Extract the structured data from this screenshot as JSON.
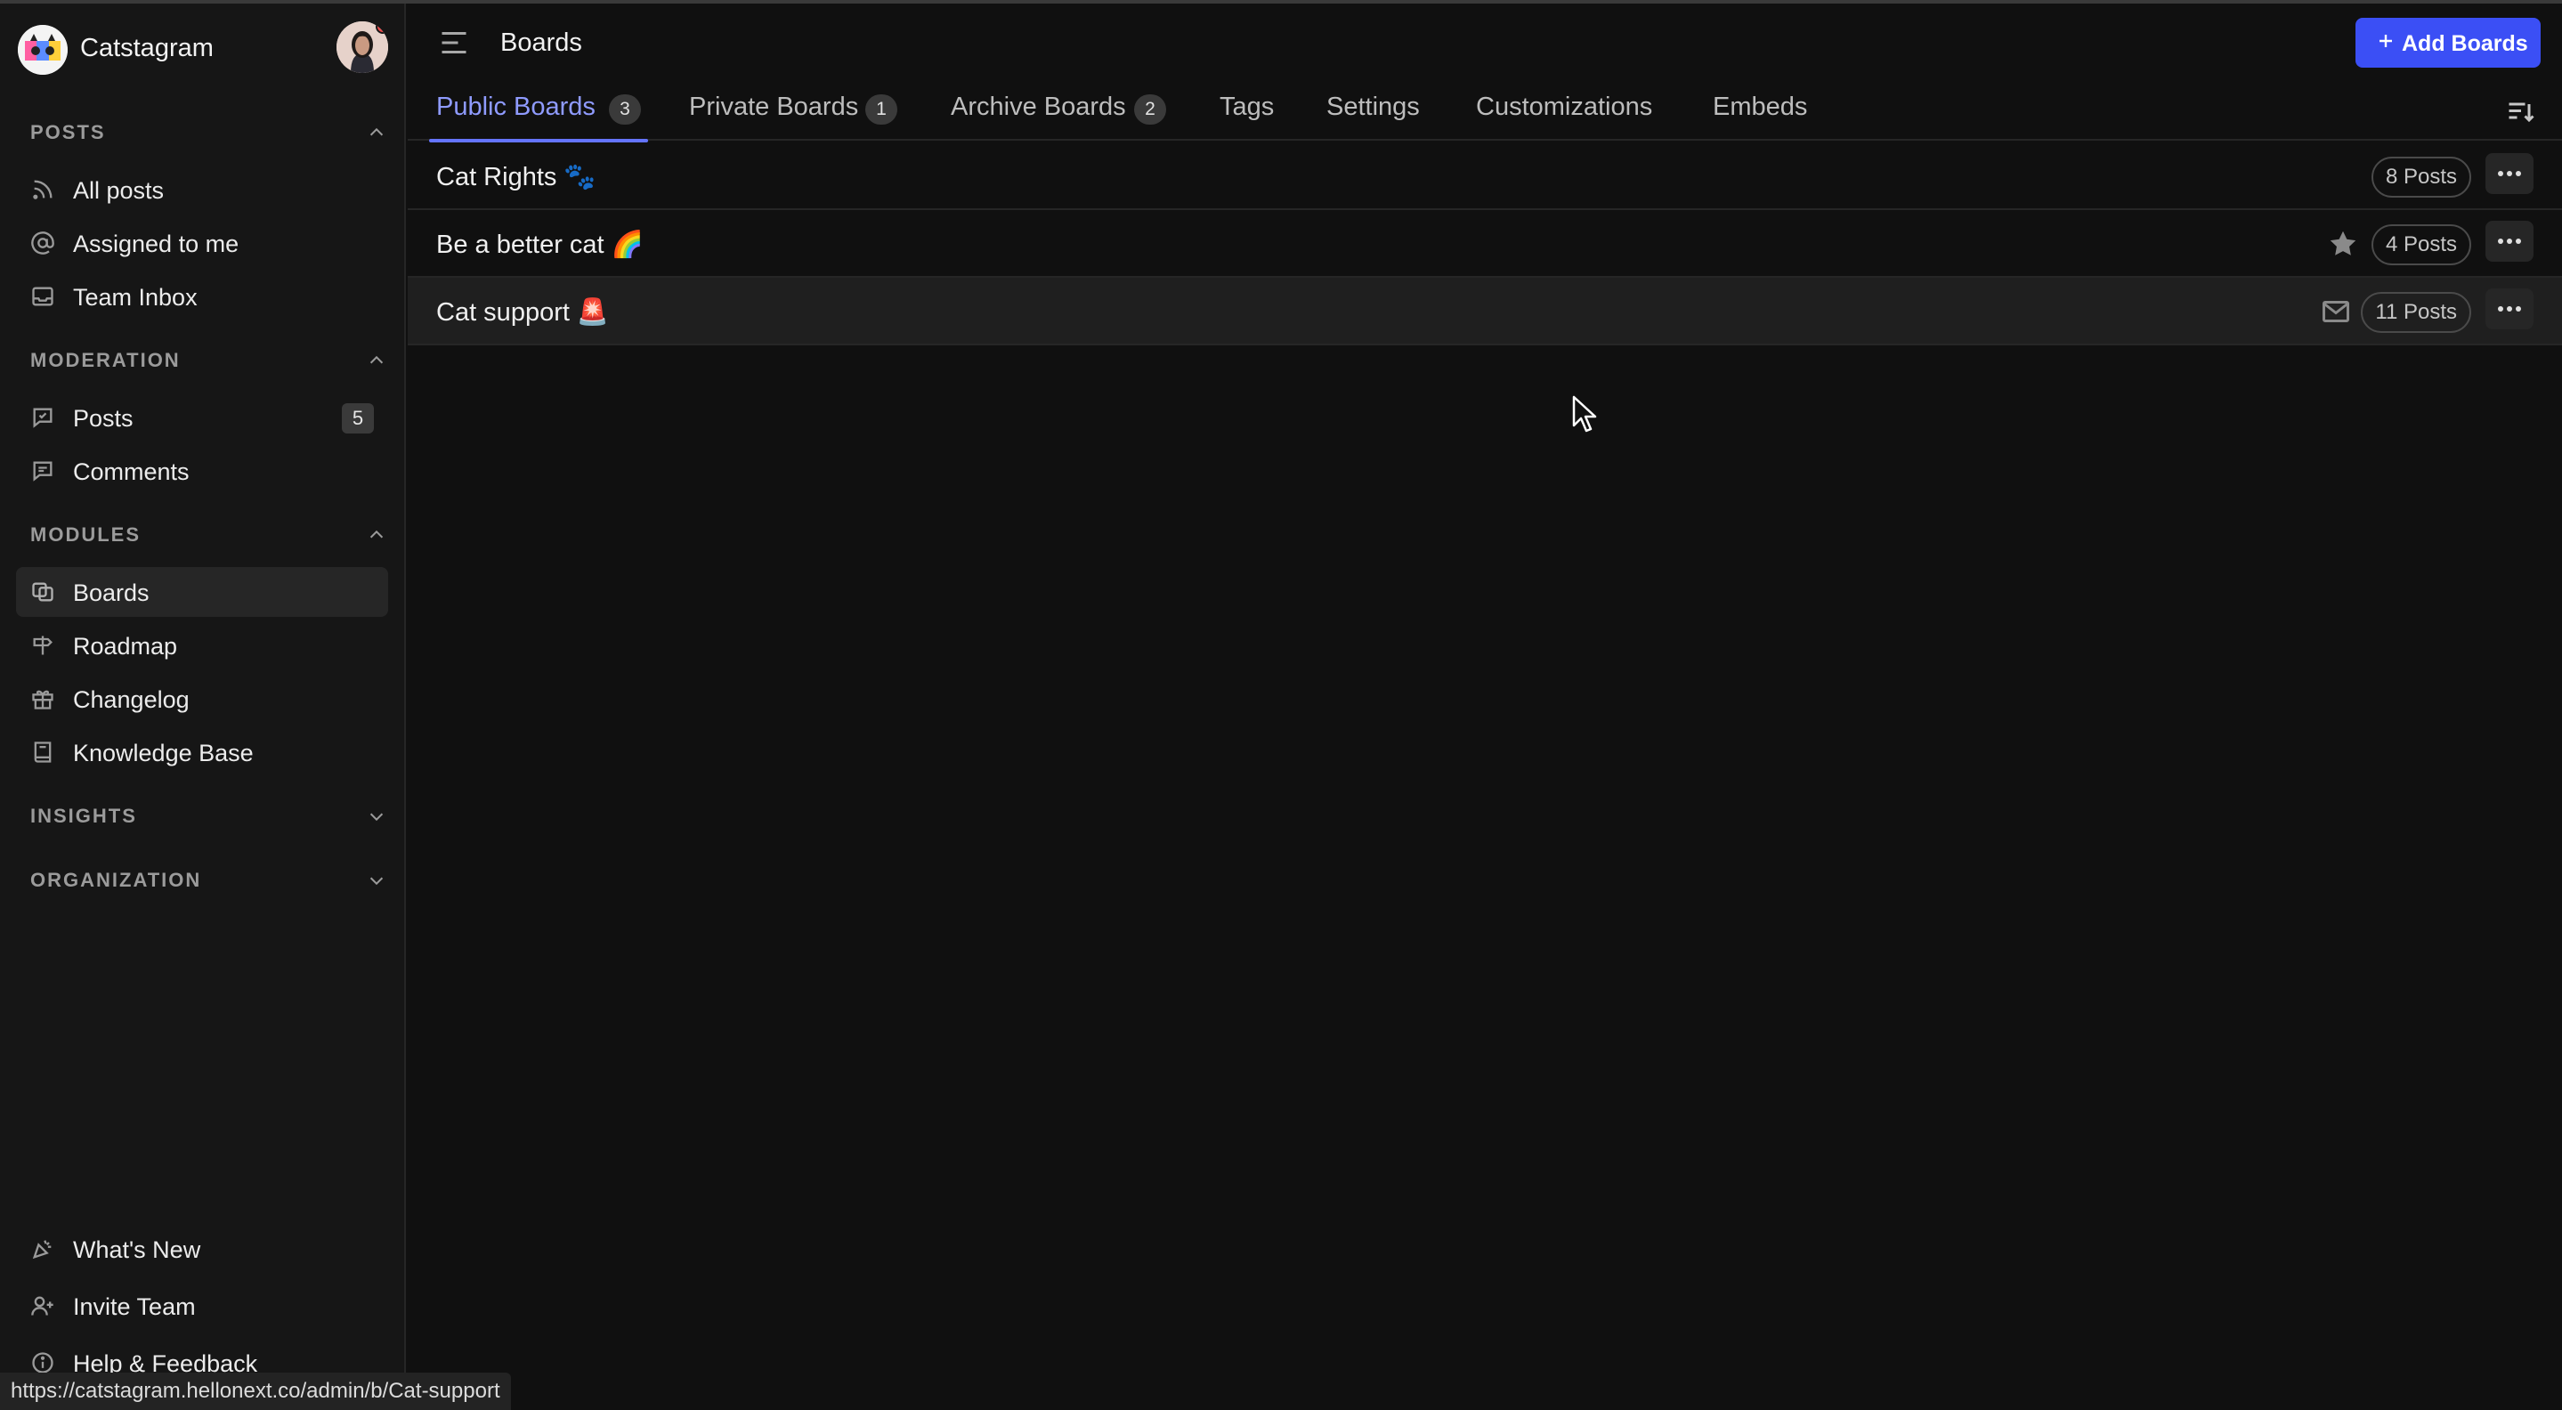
{
  "sidebar": {
    "brand_name": "Catstagram",
    "sections": {
      "posts": "POSTS",
      "moderation": "MODERATION",
      "modules": "MODULES",
      "insights": "INSIGHTS",
      "organization": "ORGANIZATION"
    },
    "items": {
      "all_posts": "All posts",
      "assigned": "Assigned to me",
      "team_inbox": "Team Inbox",
      "mod_posts": "Posts",
      "mod_posts_badge": "5",
      "comments": "Comments",
      "boards": "Boards",
      "roadmap": "Roadmap",
      "changelog": "Changelog",
      "knowledge_base": "Knowledge Base",
      "whats_new": "What's New",
      "invite_team": "Invite Team",
      "help": "Help & Feedback"
    }
  },
  "status_url": "https://catstagram.hellonext.co/admin/b/Cat-support",
  "header": {
    "title": "Boards",
    "add_button": "Add Boards"
  },
  "tabs": {
    "public": {
      "label": "Public Boards",
      "count": "3"
    },
    "private": {
      "label": "Private Boards",
      "count": "1"
    },
    "archive": {
      "label": "Archive Boards",
      "count": "2"
    },
    "tags": {
      "label": "Tags"
    },
    "settings": {
      "label": "Settings"
    },
    "customizations": {
      "label": "Customizations"
    },
    "embeds": {
      "label": "Embeds"
    }
  },
  "boards": [
    {
      "name": "Cat Rights",
      "emoji": "🐾",
      "posts": "8 Posts"
    },
    {
      "name": "Be a better cat",
      "emoji": "🌈",
      "posts": "4 Posts"
    },
    {
      "name": "Cat support",
      "emoji": "🚨",
      "posts": "11 Posts"
    }
  ],
  "colors": {
    "accent": "#3b4ff5",
    "active_tab": "#8f9bff",
    "background": "#101010",
    "sidebar": "#161616"
  },
  "icons": {
    "posts_section": [
      "rss-icon",
      "at-sign-icon",
      "inbox-icon"
    ],
    "moderation_section": [
      "message-square-icon",
      "message-lines-icon"
    ],
    "modules_section": [
      "boards-icon",
      "signpost-icon",
      "gift-icon",
      "book-icon"
    ],
    "footer": [
      "party-popper-icon",
      "user-plus-icon",
      "info-icon"
    ]
  }
}
